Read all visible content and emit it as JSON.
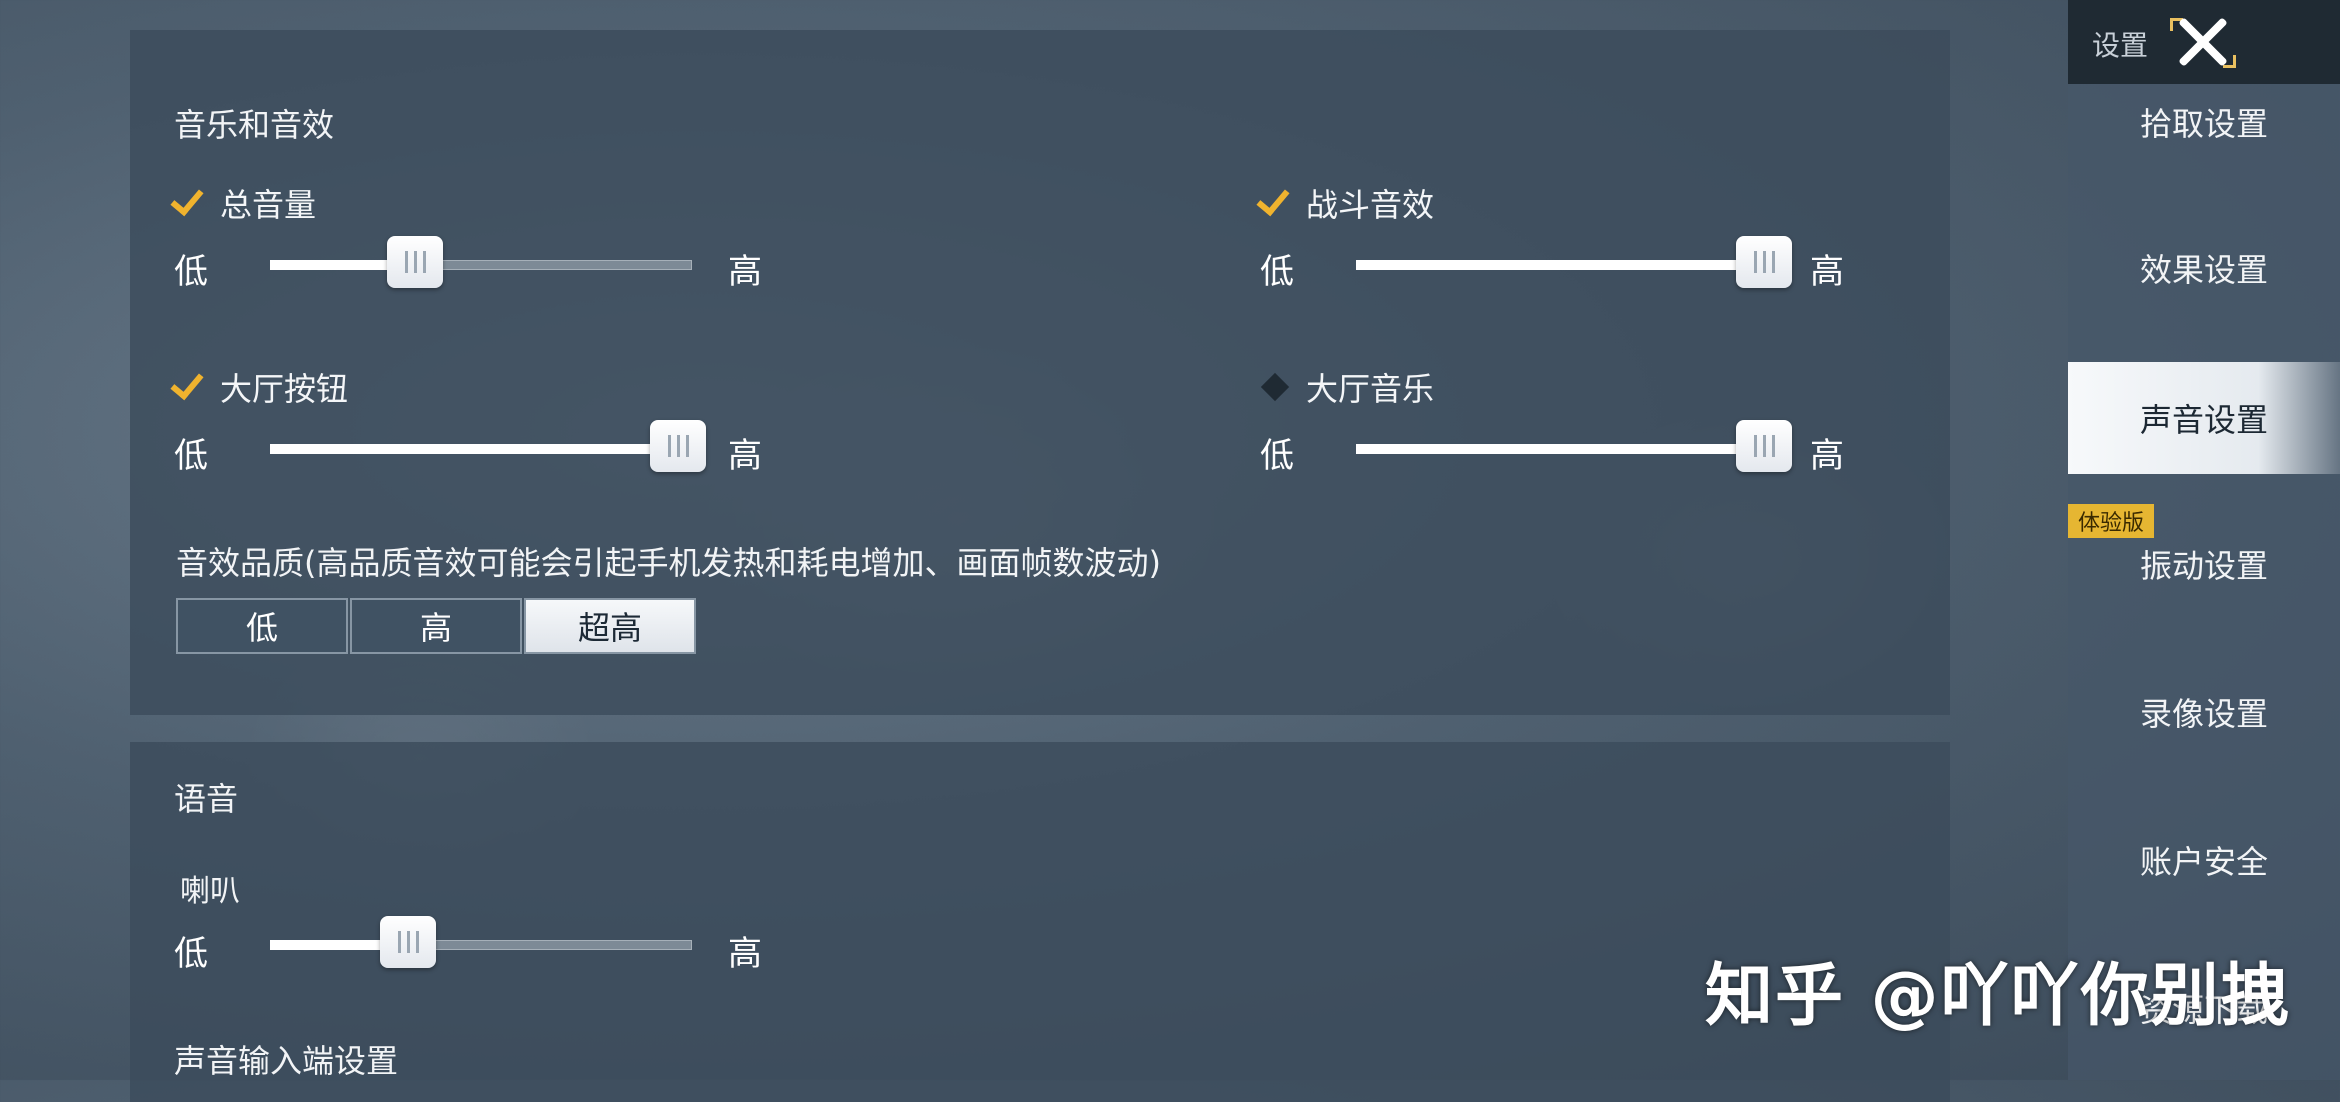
{
  "audio": {
    "title": "音乐和音效",
    "sliders": [
      {
        "label": "总音量",
        "checked": true,
        "low": "低",
        "high": "高",
        "value": 0.32
      },
      {
        "label": "战斗音效",
        "checked": true,
        "low": "低",
        "high": "高",
        "value": 1.0
      },
      {
        "label": "大厅按钮",
        "checked": true,
        "low": "低",
        "high": "高",
        "value": 1.0
      },
      {
        "label": "大厅音乐",
        "checked": false,
        "low": "低",
        "high": "高",
        "value": 1.0
      }
    ],
    "quality_note": "音效品质(高品质音效可能会引起手机发热和耗电增加、画面帧数波动)",
    "quality_options": [
      "低",
      "高",
      "超高"
    ],
    "quality_selected": "超高"
  },
  "voice": {
    "title": "语音",
    "speaker": {
      "label": "喇叭",
      "low": "低",
      "high": "高",
      "value": 0.3
    },
    "input_title": "声音输入端设置"
  },
  "sidebar": {
    "title": "设置",
    "items": [
      "拾取设置",
      "效果设置",
      "声音设置",
      "振动设置",
      "录像设置",
      "账户安全",
      "资源下载"
    ],
    "active": "声音设置",
    "trial_badge": "体验版"
  },
  "watermark": "知乎 @吖吖你别拽",
  "colors": {
    "check": "#f0b32e",
    "badge": "#e6b632",
    "panel": "#3c4c5c"
  }
}
